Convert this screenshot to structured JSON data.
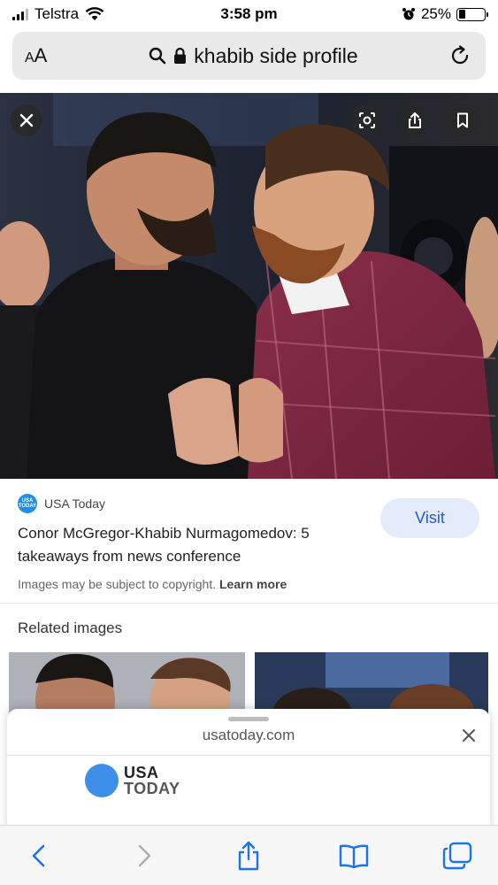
{
  "status_bar": {
    "carrier": "Telstra",
    "time": "3:58 pm",
    "battery_percent": "25%",
    "battery_level": 0.25
  },
  "address_bar": {
    "aa_small": "A",
    "aa_large": "A",
    "query": "khabib side profile",
    "icons": [
      "search-icon",
      "lock-icon",
      "reload-icon"
    ]
  },
  "hero": {
    "icons": [
      "close-icon",
      "lens-icon",
      "share-icon",
      "bookmark-icon"
    ]
  },
  "result": {
    "source_logo_text": "USA TODAY",
    "source": "USA Today",
    "visit_label": "Visit",
    "title": "Conor McGregor-Khabib Nurmagomedov: 5 takeaways from news conference",
    "copyright_text": "Images may be subject to copyright.",
    "learn_more": "Learn more"
  },
  "related": {
    "heading": "Related images"
  },
  "sheet": {
    "domain": "usatoday.com",
    "logo_line1": "USA",
    "logo_line2": "TODAY"
  },
  "toolbar": {
    "icons": [
      "back-icon",
      "forward-icon",
      "share-icon",
      "bookmarks-icon",
      "tabs-icon"
    ]
  },
  "colors": {
    "accent_blue": "#2a57c5",
    "visit_bg": "#e4ebfb",
    "toolbar_blue": "#1d73e8",
    "disabled_gray": "#b0b0b0",
    "usa_today_blue": "#3d8fe8"
  }
}
